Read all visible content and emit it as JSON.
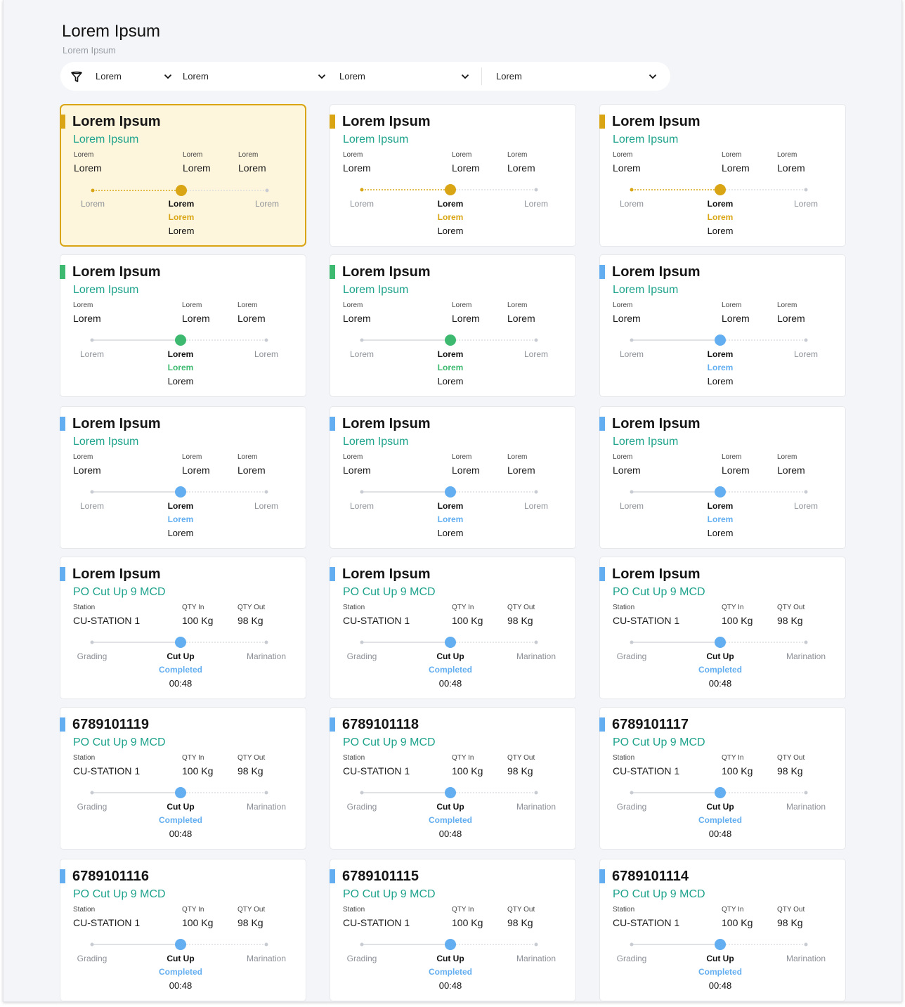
{
  "header": {
    "title": "Lorem Ipsum",
    "subtitle": "Lorem Ipsum"
  },
  "filters": [
    {
      "value": "Lorem",
      "icon": "chevron-down-icon"
    },
    {
      "value": "Lorem",
      "icon": "chevron-down-icon"
    },
    {
      "value": "Lorem",
      "icon": "chevron-down-icon"
    },
    {
      "value": "Lorem",
      "icon": "chevron-down-icon"
    }
  ],
  "colors": {
    "yellow": "#d9a514",
    "green": "#3dba6f",
    "blue": "#62aef0",
    "teal": "#1fa38c",
    "selected_bg": "#fef6dc"
  },
  "cards": [
    {
      "title": "Lorem Ipsum",
      "subtitle": "Lorem Ipsum",
      "color": "yellow",
      "selected": true,
      "fields": [
        {
          "label": "Lorem",
          "value": "Lorem"
        },
        {
          "label": "Lorem",
          "value": "Lorem"
        },
        {
          "label": "Lorem",
          "value": "Lorem"
        }
      ],
      "stages": [
        "Lorem",
        "Lorem",
        "Lorem"
      ],
      "status": "Lorem",
      "time": "Lorem"
    },
    {
      "title": "Lorem Ipsum",
      "subtitle": "Lorem Ipsum",
      "color": "yellow",
      "selected": false,
      "fields": [
        {
          "label": "Lorem",
          "value": "Lorem"
        },
        {
          "label": "Lorem",
          "value": "Lorem"
        },
        {
          "label": "Lorem",
          "value": "Lorem"
        }
      ],
      "stages": [
        "Lorem",
        "Lorem",
        "Lorem"
      ],
      "status": "Lorem",
      "time": "Lorem"
    },
    {
      "title": "Lorem Ipsum",
      "subtitle": "Lorem Ipsum",
      "color": "yellow",
      "selected": false,
      "fields": [
        {
          "label": "Lorem",
          "value": "Lorem"
        },
        {
          "label": "Lorem",
          "value": "Lorem"
        },
        {
          "label": "Lorem",
          "value": "Lorem"
        }
      ],
      "stages": [
        "Lorem",
        "Lorem",
        "Lorem"
      ],
      "status": "Lorem",
      "time": "Lorem"
    },
    {
      "title": "Lorem Ipsum",
      "subtitle": "Lorem Ipsum",
      "color": "green",
      "selected": false,
      "fields": [
        {
          "label": "Lorem",
          "value": "Lorem"
        },
        {
          "label": "Lorem",
          "value": "Lorem"
        },
        {
          "label": "Lorem",
          "value": "Lorem"
        }
      ],
      "stages": [
        "Lorem",
        "Lorem",
        "Lorem"
      ],
      "status": "Lorem",
      "time": "Lorem"
    },
    {
      "title": "Lorem Ipsum",
      "subtitle": "Lorem Ipsum",
      "color": "green",
      "selected": false,
      "fields": [
        {
          "label": "Lorem",
          "value": "Lorem"
        },
        {
          "label": "Lorem",
          "value": "Lorem"
        },
        {
          "label": "Lorem",
          "value": "Lorem"
        }
      ],
      "stages": [
        "Lorem",
        "Lorem",
        "Lorem"
      ],
      "status": "Lorem",
      "time": "Lorem"
    },
    {
      "title": "Lorem Ipsum",
      "subtitle": "Lorem Ipsum",
      "color": "blue",
      "selected": false,
      "fields": [
        {
          "label": "Lorem",
          "value": "Lorem"
        },
        {
          "label": "Lorem",
          "value": "Lorem"
        },
        {
          "label": "Lorem",
          "value": "Lorem"
        }
      ],
      "stages": [
        "Lorem",
        "Lorem",
        "Lorem"
      ],
      "status": "Lorem",
      "time": "Lorem"
    },
    {
      "title": "Lorem Ipsum",
      "subtitle": "Lorem Ipsum",
      "color": "blue",
      "selected": false,
      "fields": [
        {
          "label": "Lorem",
          "value": "Lorem"
        },
        {
          "label": "Lorem",
          "value": "Lorem"
        },
        {
          "label": "Lorem",
          "value": "Lorem"
        }
      ],
      "stages": [
        "Lorem",
        "Lorem",
        "Lorem"
      ],
      "status": "Lorem",
      "time": "Lorem"
    },
    {
      "title": "Lorem Ipsum",
      "subtitle": "Lorem Ipsum",
      "color": "blue",
      "selected": false,
      "fields": [
        {
          "label": "Lorem",
          "value": "Lorem"
        },
        {
          "label": "Lorem",
          "value": "Lorem"
        },
        {
          "label": "Lorem",
          "value": "Lorem"
        }
      ],
      "stages": [
        "Lorem",
        "Lorem",
        "Lorem"
      ],
      "status": "Lorem",
      "time": "Lorem"
    },
    {
      "title": "Lorem Ipsum",
      "subtitle": "Lorem Ipsum",
      "color": "blue",
      "selected": false,
      "fields": [
        {
          "label": "Lorem",
          "value": "Lorem"
        },
        {
          "label": "Lorem",
          "value": "Lorem"
        },
        {
          "label": "Lorem",
          "value": "Lorem"
        }
      ],
      "stages": [
        "Lorem",
        "Lorem",
        "Lorem"
      ],
      "status": "Lorem",
      "time": "Lorem"
    },
    {
      "title": "Lorem Ipsum",
      "subtitle": "PO Cut Up 9 MCD",
      "color": "blue",
      "selected": false,
      "fields": [
        {
          "label": "Station",
          "value": "CU-STATION 1"
        },
        {
          "label": "QTY In",
          "value": "100 Kg"
        },
        {
          "label": "QTY Out",
          "value": "98 Kg"
        }
      ],
      "stages": [
        "Grading",
        "Cut Up",
        "Marination"
      ],
      "status": "Completed",
      "time": "00:48"
    },
    {
      "title": "Lorem Ipsum",
      "subtitle": "PO Cut Up 9 MCD",
      "color": "blue",
      "selected": false,
      "fields": [
        {
          "label": "Station",
          "value": "CU-STATION 1"
        },
        {
          "label": "QTY In",
          "value": "100 Kg"
        },
        {
          "label": "QTY Out",
          "value": "98 Kg"
        }
      ],
      "stages": [
        "Grading",
        "Cut Up",
        "Marination"
      ],
      "status": "Completed",
      "time": "00:48"
    },
    {
      "title": "Lorem Ipsum",
      "subtitle": "PO Cut Up 9 MCD",
      "color": "blue",
      "selected": false,
      "fields": [
        {
          "label": "Station",
          "value": "CU-STATION 1"
        },
        {
          "label": "QTY In",
          "value": "100 Kg"
        },
        {
          "label": "QTY Out",
          "value": "98 Kg"
        }
      ],
      "stages": [
        "Grading",
        "Cut Up",
        "Marination"
      ],
      "status": "Completed",
      "time": "00:48"
    },
    {
      "title": "6789101119",
      "subtitle": "PO Cut Up 9 MCD",
      "color": "blue",
      "selected": false,
      "fields": [
        {
          "label": "Station",
          "value": "CU-STATION 1"
        },
        {
          "label": "QTY In",
          "value": "100 Kg"
        },
        {
          "label": "QTY Out",
          "value": "98 Kg"
        }
      ],
      "stages": [
        "Grading",
        "Cut Up",
        "Marination"
      ],
      "status": "Completed",
      "time": "00:48"
    },
    {
      "title": "6789101118",
      "subtitle": "PO Cut Up 9 MCD",
      "color": "blue",
      "selected": false,
      "fields": [
        {
          "label": "Station",
          "value": "CU-STATION 1"
        },
        {
          "label": "QTY In",
          "value": "100 Kg"
        },
        {
          "label": "QTY Out",
          "value": "98 Kg"
        }
      ],
      "stages": [
        "Grading",
        "Cut Up",
        "Marination"
      ],
      "status": "Completed",
      "time": "00:48"
    },
    {
      "title": "6789101117",
      "subtitle": "PO Cut Up 9 MCD",
      "color": "blue",
      "selected": false,
      "fields": [
        {
          "label": "Station",
          "value": "CU-STATION 1"
        },
        {
          "label": "QTY In",
          "value": "100 Kg"
        },
        {
          "label": "QTY Out",
          "value": "98 Kg"
        }
      ],
      "stages": [
        "Grading",
        "Cut Up",
        "Marination"
      ],
      "status": "Completed",
      "time": "00:48"
    },
    {
      "title": "6789101116",
      "subtitle": "PO Cut Up 9 MCD",
      "color": "blue",
      "selected": false,
      "fields": [
        {
          "label": "Station",
          "value": "CU-STATION 1"
        },
        {
          "label": "QTY In",
          "value": "100 Kg"
        },
        {
          "label": "QTY Out",
          "value": "98 Kg"
        }
      ],
      "stages": [
        "Grading",
        "Cut Up",
        "Marination"
      ],
      "status": "Completed",
      "time": "00:48"
    },
    {
      "title": "6789101115",
      "subtitle": "PO Cut Up 9 MCD",
      "color": "blue",
      "selected": false,
      "fields": [
        {
          "label": "Station",
          "value": "CU-STATION 1"
        },
        {
          "label": "QTY In",
          "value": "100 Kg"
        },
        {
          "label": "QTY Out",
          "value": "98 Kg"
        }
      ],
      "stages": [
        "Grading",
        "Cut Up",
        "Marination"
      ],
      "status": "Completed",
      "time": "00:48"
    },
    {
      "title": "6789101114",
      "subtitle": "PO Cut Up 9 MCD",
      "color": "blue",
      "selected": false,
      "fields": [
        {
          "label": "Station",
          "value": "CU-STATION 1"
        },
        {
          "label": "QTY In",
          "value": "100 Kg"
        },
        {
          "label": "QTY Out",
          "value": "98 Kg"
        }
      ],
      "stages": [
        "Grading",
        "Cut Up",
        "Marination"
      ],
      "status": "Completed",
      "time": "00:48"
    }
  ]
}
